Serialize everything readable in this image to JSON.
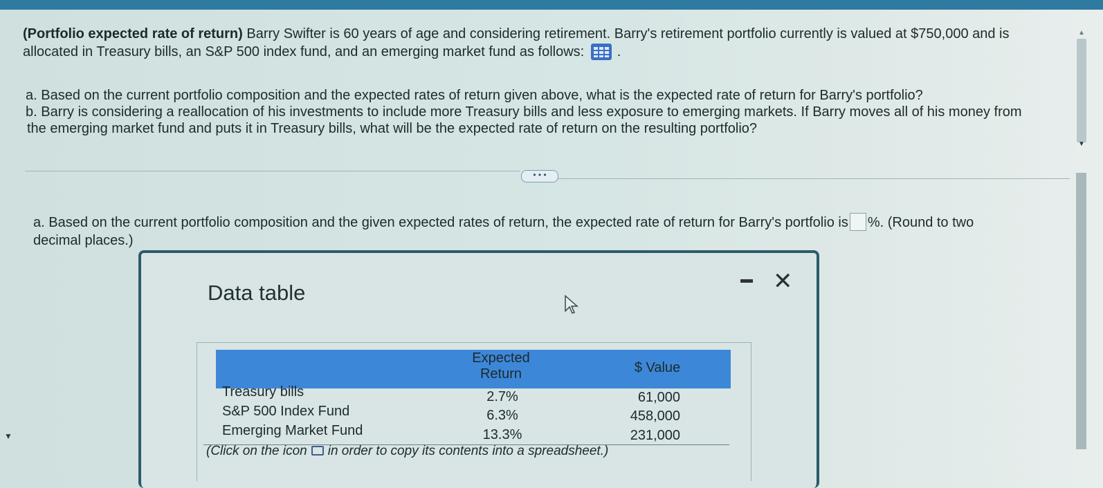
{
  "problem": {
    "title": "(Portfolio expected rate of return)",
    "line1": " Barry Swifter is 60 years of age and considering retirement. Barry's retirement portfolio currently is valued at $750,000 and is",
    "line2": "allocated in Treasury bills, an S&P 500 index fund, and an emerging market fund as follows:",
    "line2_end": " ."
  },
  "parts": {
    "a_label": "a.",
    "a_text": "Based on the current portfolio composition and the expected rates of return given above, what is the expected rate of return for Barry's portfolio?",
    "b_label": "b.",
    "b_text1": "Barry is considering a reallocation of his investments to include more Treasury bills and less exposure to emerging markets. If Barry moves all of his money from",
    "b_text2": "the emerging market fund and puts it in Treasury bills, what will be the expected rate of return on the resulting portfolio?"
  },
  "more_button": "• • •",
  "answer": {
    "label": "a.",
    "text_before": "Based on the current portfolio composition and the given expected rates of return, the expected rate of return for Barry's portfolio is",
    "text_after": "%. (Round to two",
    "line2": "decimal places.)"
  },
  "dialog": {
    "title": "Data table",
    "table": {
      "headers": [
        "Expected",
        "Return",
        "$ Value"
      ],
      "rows": [
        {
          "name": "Treasury bills",
          "return": "2.7%",
          "value": "61,000"
        },
        {
          "name": "S&P 500 Index Fund",
          "return": "6.3%",
          "value": "458,000"
        },
        {
          "name": "Emerging Market Fund",
          "return": "13.3%",
          "value": "231,000"
        }
      ]
    },
    "footnote_before": "(Click on the icon",
    "footnote_after": "in order to copy its contents into a spreadsheet.)"
  }
}
